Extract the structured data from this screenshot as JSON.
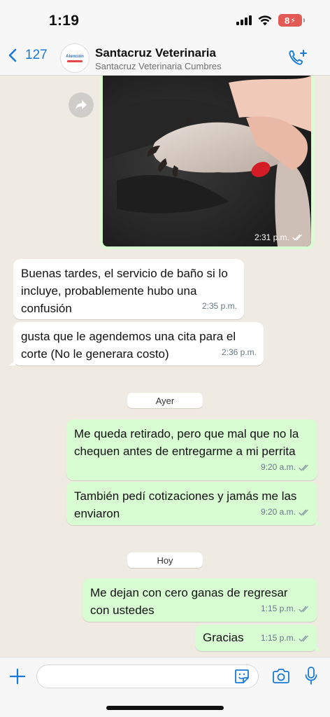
{
  "status_bar": {
    "time": "1:19",
    "battery": "8"
  },
  "header": {
    "back_count": "127",
    "contact_name": "Santacruz Veterinaria",
    "contact_subtitle": "Santacruz Veterinaria Cumbres",
    "avatar_text": "Atención"
  },
  "messages": [
    {
      "type": "image",
      "direction": "out",
      "time": "2:31 p.m."
    },
    {
      "type": "text",
      "direction": "in",
      "text": "Buenas tardes, el servicio de baño si lo incluye, probablemente hubo una confusión",
      "time": "2:35 p.m."
    },
    {
      "type": "text",
      "direction": "in",
      "text": "gusta que le agendemos una cita para el corte (No le generara costo)",
      "time": "2:36 p.m."
    },
    {
      "type": "date",
      "text": "Ayer"
    },
    {
      "type": "text",
      "direction": "out",
      "text": "Me queda retirado, pero que mal que no la chequen antes de entregarme a mi perrita",
      "time": "9:20 a.m."
    },
    {
      "type": "text",
      "direction": "out",
      "text": "También pedí cotizaciones y jamás me las enviaron",
      "time": "9:20 a.m."
    },
    {
      "type": "date",
      "text": "Hoy"
    },
    {
      "type": "text",
      "direction": "out",
      "text": "Me dejan con cero ganas de regresar con ustedes",
      "time": "1:15 p.m."
    },
    {
      "type": "text",
      "direction": "out",
      "text": "Gracias",
      "time": "1:15 p.m."
    }
  ],
  "input": {
    "placeholder": ""
  },
  "icons": {
    "back": "chevron-left-icon",
    "call": "phone-plus-icon",
    "forward": "forward-arrow-icon",
    "read": "double-check-icon",
    "plus": "plus-icon",
    "sticker": "sticker-icon",
    "camera": "camera-icon",
    "mic": "microphone-icon"
  },
  "colors": {
    "accent": "#1a7ad8",
    "outgoing_bubble": "#d9fdd3",
    "incoming_bubble": "#ffffff",
    "chat_background": "#efeae2",
    "read_check": "#8a9aa4"
  }
}
